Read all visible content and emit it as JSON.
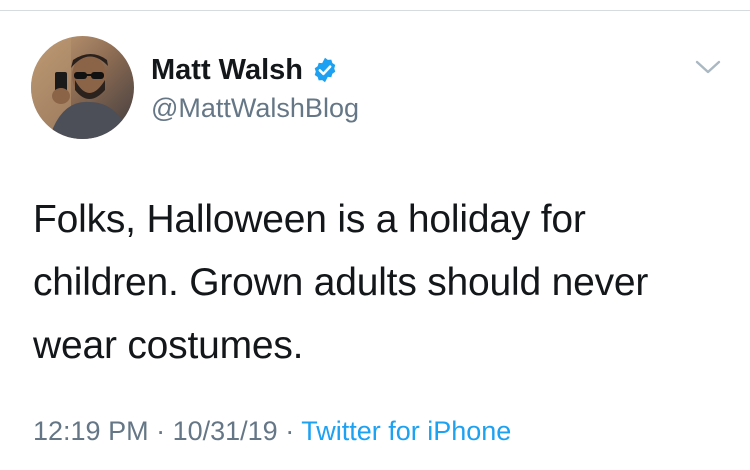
{
  "tweet": {
    "author": {
      "display_name": "Matt Walsh",
      "handle": "@MattWalshBlog",
      "verified": true
    },
    "text_lines": [
      "Folks, Halloween is a holiday for",
      "children. Grown adults should never",
      "wear costumes."
    ],
    "time": "12:19 PM",
    "date": "10/31/19",
    "separator": " · ",
    "source": "Twitter for iPhone"
  },
  "icons": {
    "verified": "verified-badge-icon",
    "menu": "chevron-down-icon"
  },
  "colors": {
    "text": "#14171a",
    "secondary": "#657786",
    "link": "#1da1f2",
    "verified": "#1da1f2"
  }
}
